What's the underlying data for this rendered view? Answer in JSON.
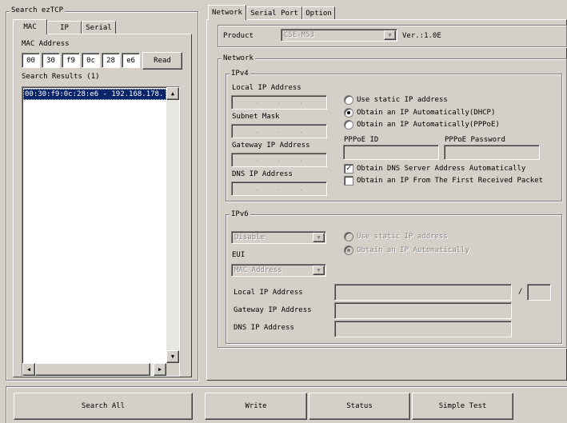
{
  "search_panel": {
    "title": "Search ezTCP",
    "tabs": [
      "MAC",
      "IP",
      "Serial"
    ],
    "mac_address_label": "MAC Address",
    "mac_octets": [
      "00",
      "30",
      "f9",
      "0c",
      "28",
      "e6"
    ],
    "read_label": "Read",
    "results_label": "Search Results (1)",
    "results": [
      "00:30:f9:0c:28:e6 - 192.168.178."
    ]
  },
  "config_tabs": [
    "Network",
    "Serial Port",
    "Option"
  ],
  "product": {
    "label": "Product",
    "value": "CSE-M53",
    "version": "Ver.:1.0E"
  },
  "network": {
    "title": "Network",
    "ipv4": {
      "title": "IPv4",
      "local_ip_label": "Local IP Address",
      "subnet_label": "Subnet Mask",
      "gateway_label": "Gateway IP Address",
      "dns_label": "DNS IP Address",
      "radio_static": "Use static IP address",
      "radio_dhcp": "Obtain an IP Automatically(DHCP)",
      "radio_pppoe": "Obtain an IP Automatically(PPPoE)",
      "pppoe_id_label": "PPPoE ID",
      "pppoe_password_label": "PPPoE Password",
      "check_dns": "Obtain DNS Server Address Automatically",
      "check_first_packet": "Obtain an IP From The First Received Packet",
      "selected_mode": "dhcp",
      "dns_auto_checked": true,
      "first_packet_checked": false
    },
    "ipv6": {
      "title": "IPv6",
      "mode_value": "Disable",
      "radio_static": "Use static IP address",
      "radio_auto": "Obtain an IP Automatically",
      "eui_label": "EUI",
      "eui_value": "MAC Address",
      "local_ip_label": "Local IP Address",
      "prefix_separator": "/",
      "gateway_label": "Gateway IP Address",
      "dns_label": "DNS IP Address"
    }
  },
  "buttons": {
    "search_all": "Search All",
    "write": "Write",
    "status": "Status",
    "simple_test": "Simple Test"
  },
  "ip_dot": "."
}
